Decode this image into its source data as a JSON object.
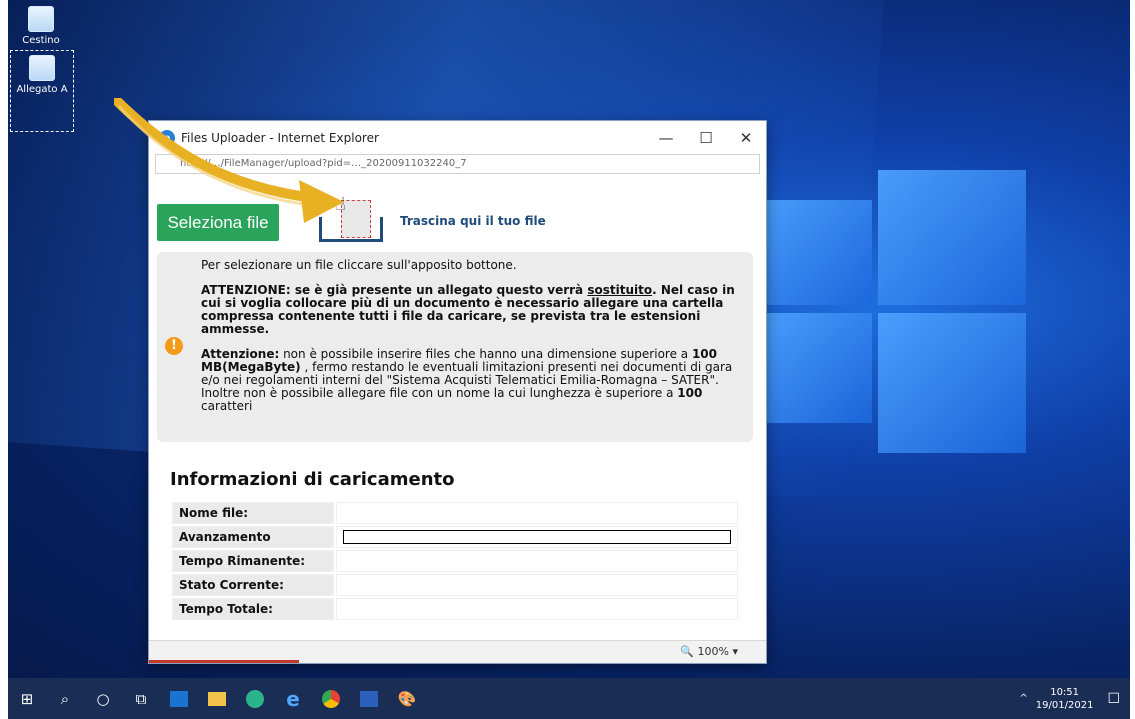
{
  "desktop": {
    "icons": [
      {
        "label": "Cestino",
        "icon": "recycle-bin-icon"
      },
      {
        "label": "Allegato A",
        "icon": "word-document-icon"
      }
    ]
  },
  "window": {
    "title": "Files Uploader - Internet Explorer",
    "address": "http://…/FileManager/upload?pid=…_20200911032240_7",
    "controls": {
      "minimize": "—",
      "maximize": "☐",
      "close": "✕"
    }
  },
  "uploader": {
    "select_button": "Seleziona file",
    "drop_label": "Trascina qui il tuo file",
    "info": {
      "line1": "Per selezionare un file cliccare sull'apposito bottone.",
      "warning_prefix": "ATTENZIONE: se è già presente un allegato questo verrà ",
      "warning_underline": "sostituito",
      "warning_suffix": ". Nel caso in cui si voglia collocare più di un documento è necessario allegare una cartella compressa contenente tutti i file da caricare, se prevista tra le estensioni ammesse.",
      "attenzione_label": "Attenzione:",
      "attenzione_text_1": " non è possibile inserire files che hanno una dimensione superiore a ",
      "size_limit": "100 MB(MegaByte)",
      "attenzione_text_2": " , fermo restando le eventuali limitazioni presenti nei documenti di gara e/o nei regolamenti interni del \"Sistema Acquisti Telematici Emilia-Romagna – SATER\". Inoltre non è possibile allegare file con un nome la cui lunghezza è superiore a ",
      "name_limit": "100",
      "attenzione_text_3": " caratteri"
    }
  },
  "upload_info": {
    "title": "Informazioni di caricamento",
    "rows": [
      {
        "label": "Nome file:",
        "value": ""
      },
      {
        "label": "Avanzamento",
        "value": ""
      },
      {
        "label": "Tempo Rimanente:",
        "value": ""
      },
      {
        "label": "Stato Corrente:",
        "value": ""
      },
      {
        "label": "Tempo Totale:",
        "value": ""
      }
    ],
    "progress": 0
  },
  "statusbar": {
    "zoom": "100%"
  },
  "taskbar": {
    "items": [
      "start-icon",
      "search-icon",
      "cortana-icon",
      "task-view-icon",
      "outlook-icon",
      "file-explorer-icon",
      "edge-icon",
      "internet-explorer-icon",
      "chrome-icon",
      "word-icon",
      "paint-icon"
    ],
    "time": "10:51",
    "date": "19/01/2021"
  }
}
